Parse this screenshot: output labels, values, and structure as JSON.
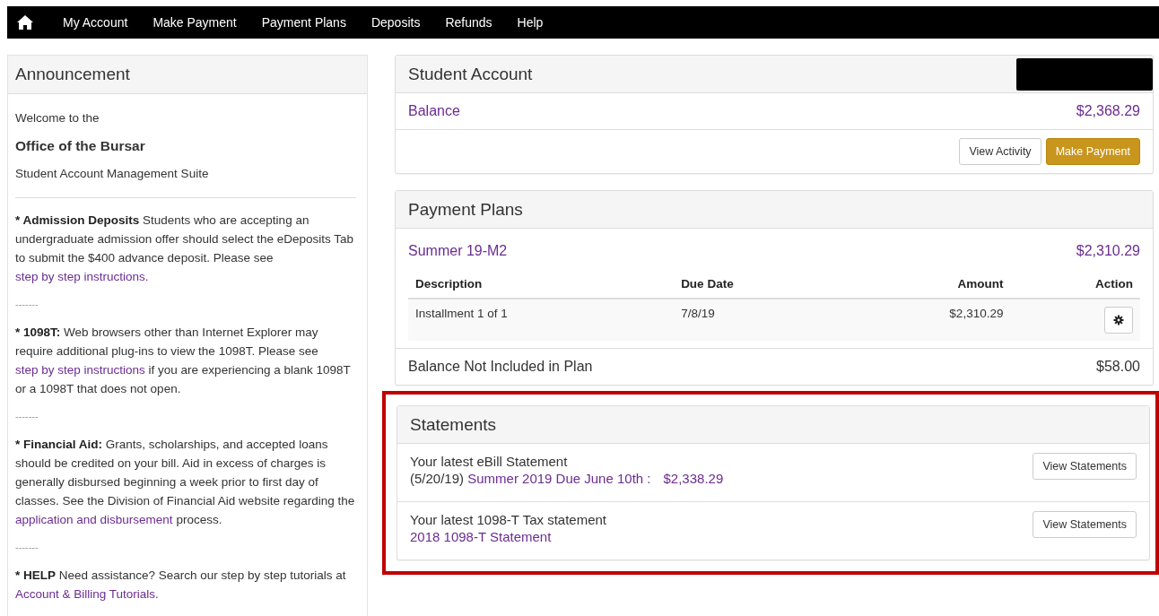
{
  "nav": {
    "items": [
      "My Account",
      "Make Payment",
      "Payment Plans",
      "Deposits",
      "Refunds",
      "Help"
    ]
  },
  "announcement": {
    "title": "Announcement",
    "welcome": "Welcome to the",
    "office": "Office of the Bursar",
    "suite": "Student Account Management Suite",
    "paragraphs": [
      [
        {
          "kind": "bold",
          "text": "* Admission Deposits"
        },
        {
          "kind": "plain",
          "text": " Students who are accepting an undergraduate admission offer should select the eDeposits Tab to submit the $400 advance deposit. Please see "
        },
        {
          "kind": "link",
          "text": "step by step instructions."
        }
      ],
      [
        {
          "kind": "bold",
          "text": "* 1098T:"
        },
        {
          "kind": "plain",
          "text": " Web browsers other than Internet Explorer may require additional plug-ins to view the 1098T. Please see "
        },
        {
          "kind": "link",
          "text": "step by step instructions"
        },
        {
          "kind": "plain",
          "text": " if you are experiencing a blank 1098T or a 1098T that does not open."
        }
      ],
      [
        {
          "kind": "bold",
          "text": "* Financial Aid:"
        },
        {
          "kind": "plain",
          "text": " Grants, scholarships, and accepted loans should be credited on your bill. Aid in excess of charges is generally disbursed beginning a week prior to first day of classes. See the Division of Financial Aid website regarding the "
        },
        {
          "kind": "link",
          "text": "application and disbursement"
        },
        {
          "kind": "plain",
          "text": " process."
        }
      ],
      [
        {
          "kind": "bold",
          "text": "* HELP"
        },
        {
          "kind": "plain",
          "text": " Need assistance? Search our step by step tutorials at "
        },
        {
          "kind": "link",
          "text": "Account & Billing Tutorials."
        }
      ]
    ],
    "separator": "-------"
  },
  "student_account": {
    "title": "Student Account",
    "balance_label": "Balance",
    "balance": "$2,368.29",
    "buttons": [
      {
        "label": "View Activity",
        "kind": "default"
      },
      {
        "label": "Make Payment",
        "kind": "primary"
      }
    ]
  },
  "payment_plans": {
    "title": "Payment Plans",
    "plan": "Summer 19-M2",
    "plan_amount": "$2,310.29",
    "columns": [
      "Description",
      "Due Date",
      "Amount",
      "Action"
    ],
    "rows": [
      {
        "description": "Installment 1 of 1",
        "due_date": "7/8/19",
        "amount": "$2,310.29"
      }
    ],
    "not_included_label": "Balance Not Included in Plan",
    "not_included": "$58.00"
  },
  "statements": {
    "title": "Statements",
    "highlighted": true,
    "items": [
      {
        "line1": "Your latest eBill Statement",
        "prefix": "(5/20/19) ",
        "link": "Summer 2019 Due June 10th :",
        "amount": "$2,338.29",
        "button": "View Statements"
      },
      {
        "line1": "Your latest 1098-T Tax statement",
        "link": "2018 1098-T Statement",
        "button": "View Statements"
      }
    ]
  }
}
